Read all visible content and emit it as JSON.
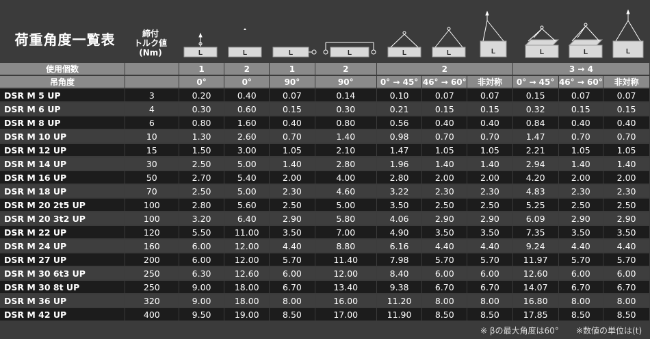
{
  "title": "荷重角度一覧表",
  "torque_header": [
    "締付",
    "トルク値",
    "(Nm)"
  ],
  "icon_label": "L",
  "header_rows": {
    "usage_label": "使用個数",
    "angle_label": "吊角度",
    "usage": [
      "1",
      "2",
      "1",
      "2",
      "2",
      "3 → 4"
    ],
    "angles": [
      "0°",
      "0°",
      "90°",
      "90°",
      "0° → 45°",
      "46° → 60°",
      "非対称",
      "0° → 45°",
      "46° → 60°",
      "非対称"
    ]
  },
  "rows": [
    {
      "name": "DSR M 5 UP",
      "torque": "3",
      "v": [
        "0.20",
        "0.40",
        "0.07",
        "0.14",
        "0.10",
        "0.07",
        "0.07",
        "0.15",
        "0.07",
        "0.07"
      ]
    },
    {
      "name": "DSR M 6 UP",
      "torque": "4",
      "v": [
        "0.30",
        "0.60",
        "0.15",
        "0.30",
        "0.21",
        "0.15",
        "0.15",
        "0.32",
        "0.15",
        "0.15"
      ]
    },
    {
      "name": "DSR M 8 UP",
      "torque": "6",
      "v": [
        "0.80",
        "1.60",
        "0.40",
        "0.80",
        "0.56",
        "0.40",
        "0.40",
        "0.84",
        "0.40",
        "0.40"
      ]
    },
    {
      "name": "DSR M 10 UP",
      "torque": "10",
      "v": [
        "1.30",
        "2.60",
        "0.70",
        "1.40",
        "0.98",
        "0.70",
        "0.70",
        "1.47",
        "0.70",
        "0.70"
      ]
    },
    {
      "name": "DSR M 12 UP",
      "torque": "15",
      "v": [
        "1.50",
        "3.00",
        "1.05",
        "2.10",
        "1.47",
        "1.05",
        "1.05",
        "2.21",
        "1.05",
        "1.05"
      ]
    },
    {
      "name": "DSR M 14 UP",
      "torque": "30",
      "v": [
        "2.50",
        "5.00",
        "1.40",
        "2.80",
        "1.96",
        "1.40",
        "1.40",
        "2.94",
        "1.40",
        "1.40"
      ]
    },
    {
      "name": "DSR M 16 UP",
      "torque": "50",
      "v": [
        "2.70",
        "5.40",
        "2.00",
        "4.00",
        "2.80",
        "2.00",
        "2.00",
        "4.20",
        "2.00",
        "2.00"
      ]
    },
    {
      "name": "DSR M 18 UP",
      "torque": "70",
      "v": [
        "2.50",
        "5.00",
        "2.30",
        "4.60",
        "3.22",
        "2.30",
        "2.30",
        "4.83",
        "2.30",
        "2.30"
      ]
    },
    {
      "name": "DSR M 20 2t5 UP",
      "torque": "100",
      "v": [
        "2.80",
        "5.60",
        "2.50",
        "5.00",
        "3.50",
        "2.50",
        "2.50",
        "5.25",
        "2.50",
        "2.50"
      ]
    },
    {
      "name": "DSR M 20 3t2 UP",
      "torque": "100",
      "v": [
        "3.20",
        "6.40",
        "2.90",
        "5.80",
        "4.06",
        "2.90",
        "2.90",
        "6.09",
        "2.90",
        "2.90"
      ]
    },
    {
      "name": "DSR M 22 UP",
      "torque": "120",
      "v": [
        "5.50",
        "11.00",
        "3.50",
        "7.00",
        "4.90",
        "3.50",
        "3.50",
        "7.35",
        "3.50",
        "3.50"
      ]
    },
    {
      "name": "DSR M 24 UP",
      "torque": "160",
      "v": [
        "6.00",
        "12.00",
        "4.40",
        "8.80",
        "6.16",
        "4.40",
        "4.40",
        "9.24",
        "4.40",
        "4.40"
      ]
    },
    {
      "name": "DSR M 27 UP",
      "torque": "200",
      "v": [
        "6.00",
        "12.00",
        "5.70",
        "11.40",
        "7.98",
        "5.70",
        "5.70",
        "11.97",
        "5.70",
        "5.70"
      ]
    },
    {
      "name": "DSR M 30 6t3 UP",
      "torque": "250",
      "v": [
        "6.30",
        "12.60",
        "6.00",
        "12.00",
        "8.40",
        "6.00",
        "6.00",
        "12.60",
        "6.00",
        "6.00"
      ]
    },
    {
      "name": "DSR M 30 8t UP",
      "torque": "250",
      "v": [
        "9.00",
        "18.00",
        "6.70",
        "13.40",
        "9.38",
        "6.70",
        "6.70",
        "14.07",
        "6.70",
        "6.70"
      ]
    },
    {
      "name": "DSR M 36 UP",
      "torque": "320",
      "v": [
        "9.00",
        "18.00",
        "8.00",
        "16.00",
        "11.20",
        "8.00",
        "8.00",
        "16.80",
        "8.00",
        "8.00"
      ]
    },
    {
      "name": "DSR M 42 UP",
      "torque": "400",
      "v": [
        "9.50",
        "19.00",
        "8.50",
        "17.00",
        "11.90",
        "8.50",
        "8.50",
        "17.85",
        "8.50",
        "8.50"
      ]
    }
  ],
  "footnotes": {
    "beta": "※ βの最大角度は60°",
    "unit": "※数値の単位は(t)"
  }
}
